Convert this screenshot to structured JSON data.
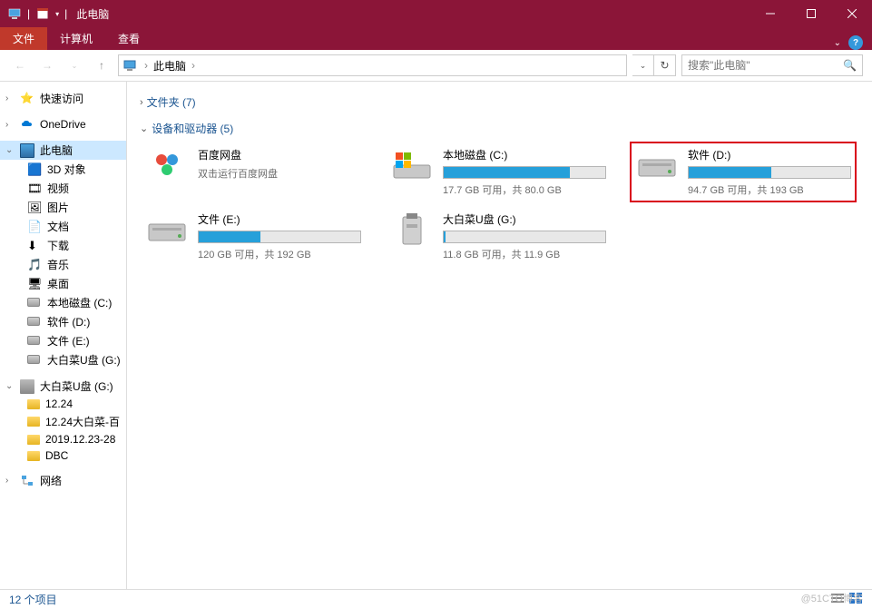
{
  "title": "此电脑",
  "ribbon": {
    "tabs": [
      "文件",
      "计算机",
      "查看"
    ],
    "active": 0
  },
  "breadcrumb": {
    "root": "此电脑"
  },
  "search": {
    "placeholder": "搜索\"此电脑\""
  },
  "sidebar": {
    "quick": "快速访问",
    "onedrive": "OneDrive",
    "thispc": "此电脑",
    "pc_children": [
      "3D 对象",
      "视频",
      "图片",
      "文档",
      "下载",
      "音乐",
      "桌面",
      "本地磁盘 (C:)",
      "软件 (D:)",
      "文件 (E:)",
      "大白菜U盘 (G:)"
    ],
    "usb_root": "大白菜U盘 (G:)",
    "usb_children": [
      "12.24",
      "12.24大白菜-百",
      "2019.12.23-28",
      "DBC"
    ],
    "network": "网络"
  },
  "sections": {
    "folders": {
      "label": "文件夹 (7)",
      "expanded": false
    },
    "devices": {
      "label": "设备和驱动器 (5)",
      "expanded": true
    }
  },
  "devices": [
    {
      "name": "百度网盘",
      "sub": "双击运行百度网盘",
      "type": "app",
      "icon": "baidu"
    },
    {
      "name": "本地磁盘 (C:)",
      "sub": "17.7 GB 可用，共 80.0 GB",
      "type": "drive",
      "fill": 78,
      "icon": "win"
    },
    {
      "name": "软件 (D:)",
      "sub": "94.7 GB 可用，共 193 GB",
      "type": "drive",
      "fill": 51,
      "highlighted": true
    },
    {
      "name": "文件 (E:)",
      "sub": "120 GB 可用，共 192 GB",
      "type": "drive",
      "fill": 38
    },
    {
      "name": "大白菜U盘 (G:)",
      "sub": "11.8 GB 可用，共 11.9 GB",
      "type": "drive",
      "fill": 1,
      "icon": "usb"
    }
  ],
  "status": "12 个项目",
  "watermark": "@51CTO博客"
}
